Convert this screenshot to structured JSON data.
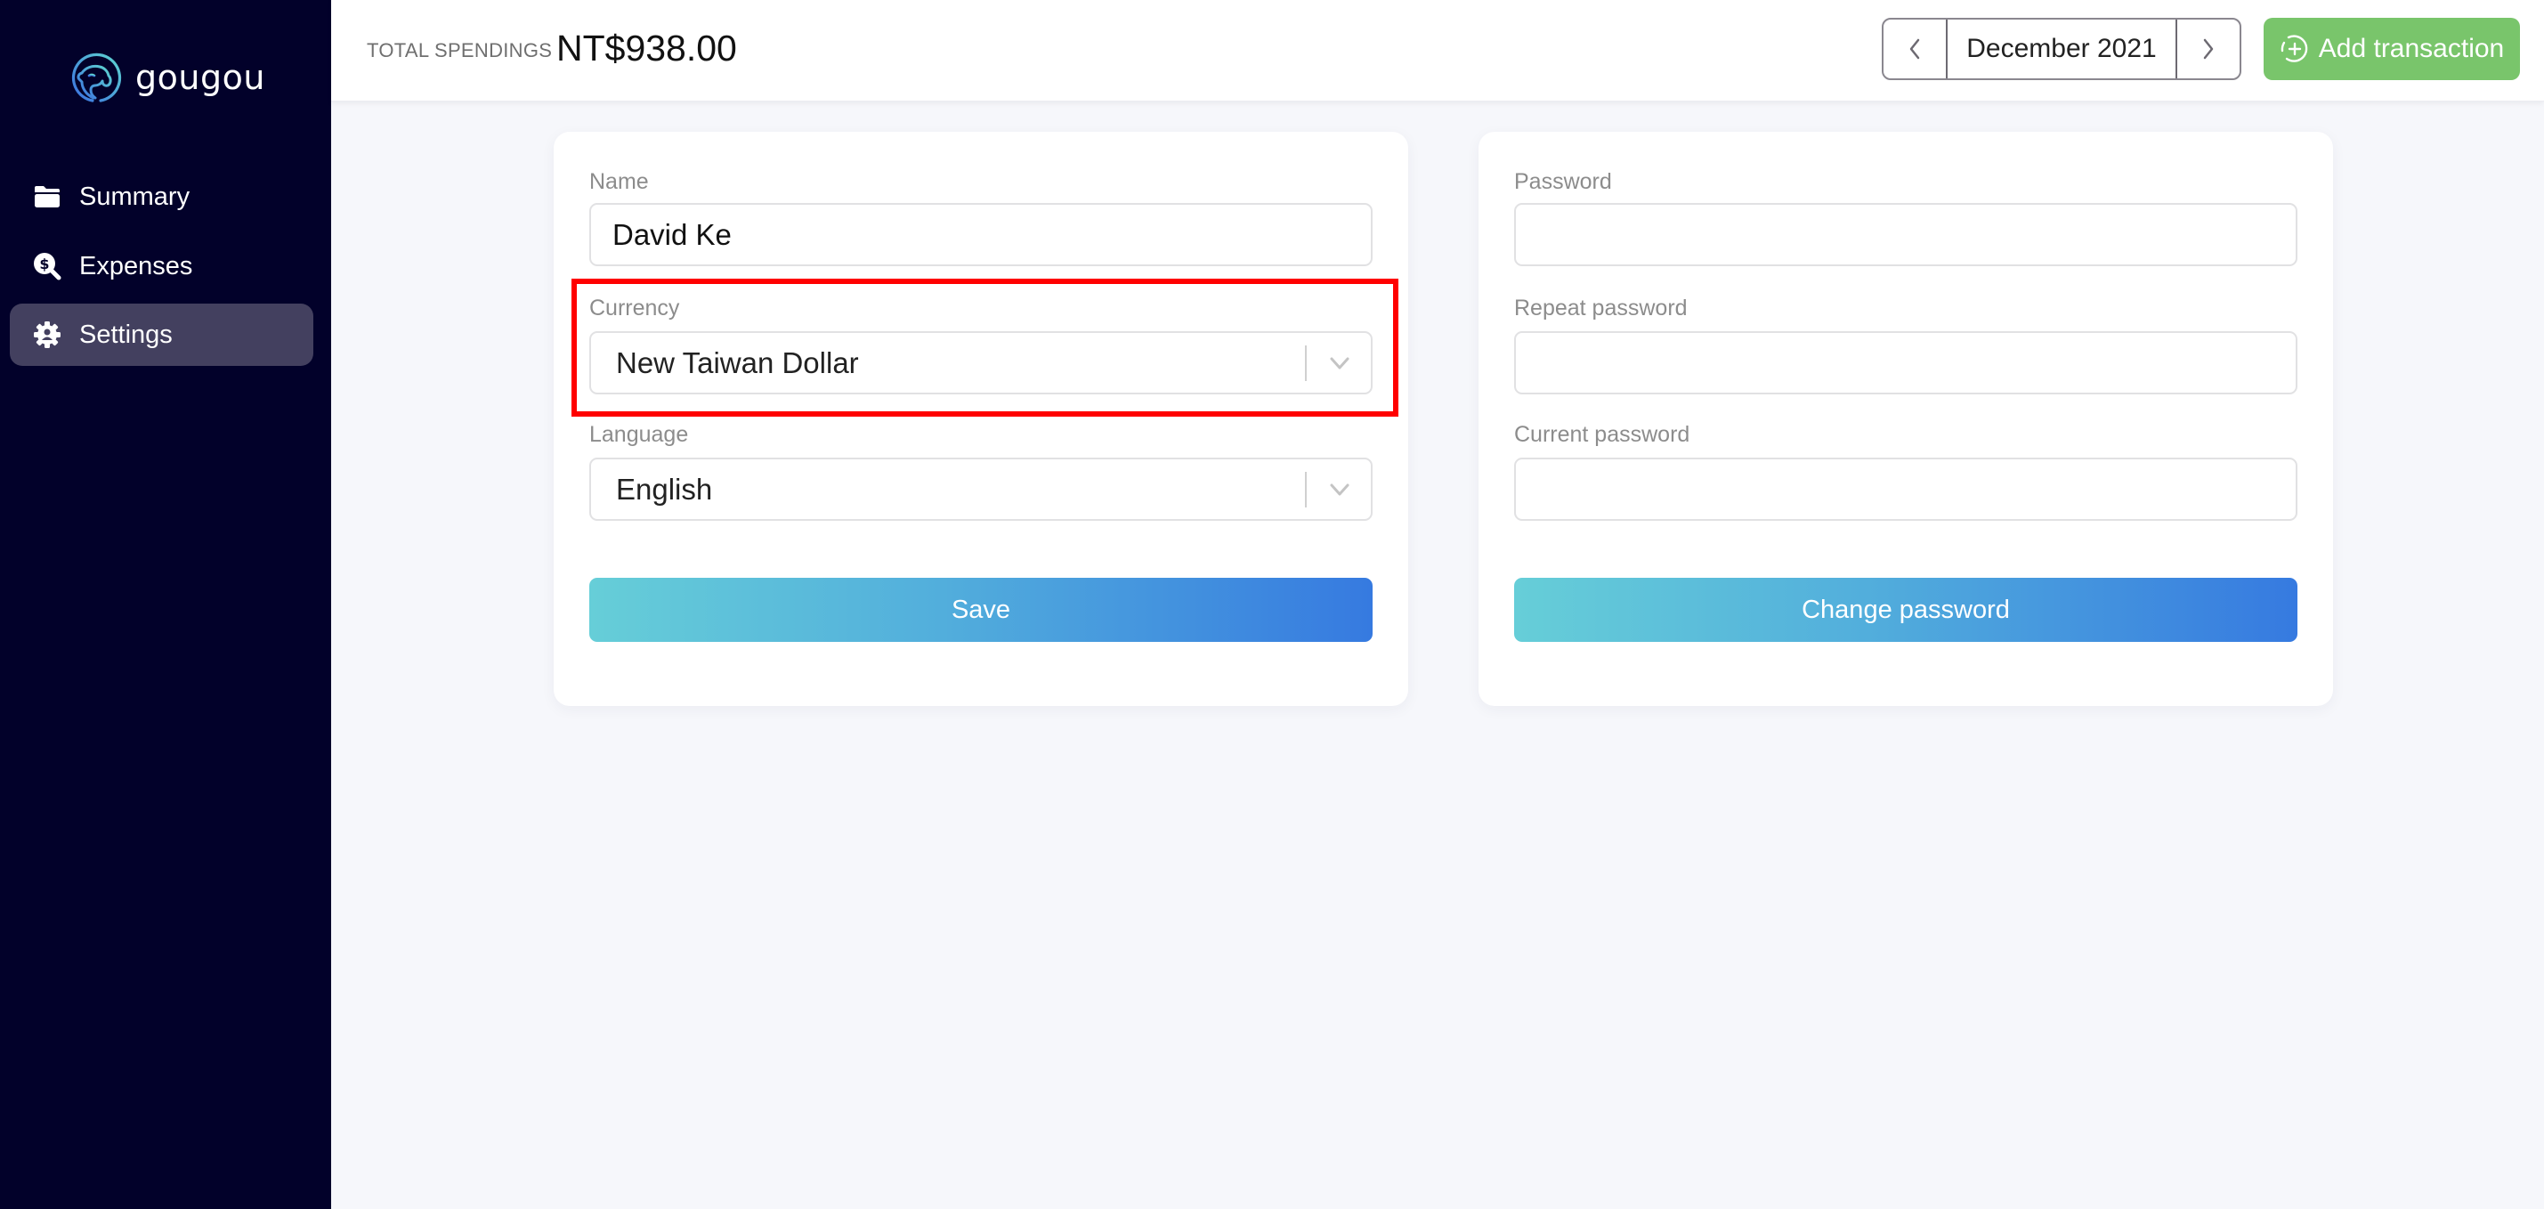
{
  "app": {
    "name": "gougou",
    "brand_colors": {
      "sidebar_bg": "#02012a",
      "active_nav_bg": "#43405f",
      "add_button": "#79c56b",
      "gradient_start": "#66ced8",
      "gradient_end": "#367ae0",
      "highlight": "#ff0000"
    }
  },
  "sidebar": {
    "logo_icon": "dog-head-icon",
    "items": [
      {
        "label": "Summary",
        "icon": "folder-icon",
        "active": false
      },
      {
        "label": "Expenses",
        "icon": "search-dollar-icon",
        "active": false
      },
      {
        "label": "Settings",
        "icon": "user-gear-icon",
        "active": true
      }
    ]
  },
  "header": {
    "total_label": "TOTAL SPENDINGS",
    "total_value": "NT$938.00",
    "month_nav": {
      "prev_icon": "chevron-left-icon",
      "current": "December 2021",
      "next_icon": "chevron-right-icon"
    },
    "add_button": {
      "label": "Add transaction",
      "icon": "plus-circle-icon"
    }
  },
  "profile_form": {
    "name": {
      "label": "Name",
      "value": "David Ke"
    },
    "currency": {
      "label": "Currency",
      "selected": "New Taiwan Dollar"
    },
    "language": {
      "label": "Language",
      "selected": "English"
    },
    "save_label": "Save"
  },
  "password_form": {
    "password": {
      "label": "Password",
      "value": ""
    },
    "repeat_password": {
      "label": "Repeat password",
      "value": ""
    },
    "current_password": {
      "label": "Current password",
      "value": ""
    },
    "submit_label": "Change password"
  }
}
